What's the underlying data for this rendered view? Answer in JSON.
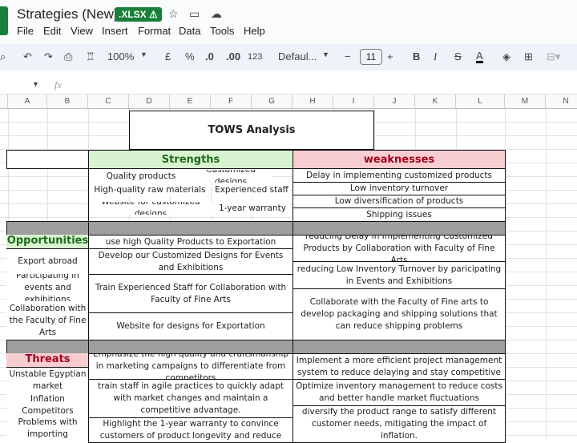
{
  "app": {
    "title": "Strategies (New)",
    "badge": ".XLSX ⚠",
    "icons": [
      "star-icon",
      "move-to-folder-icon",
      "cloud-status-icon"
    ]
  },
  "menu": [
    "File",
    "Edit",
    "View",
    "Insert",
    "Format",
    "Data",
    "Tools",
    "Help"
  ],
  "toolbar": {
    "zoom": "100%",
    "currency": "£",
    "percent": "%",
    "dec_decrease": ".0",
    "dec_increase": ".00",
    "number_format": "123",
    "font": "Defaul...",
    "font_size": "11",
    "minus": "−",
    "plus": "+",
    "bold": "B",
    "italic": "I",
    "strike": "S",
    "text_color": "A",
    "text_color_value": "#000000"
  },
  "formula_bar": {
    "fx": "fx",
    "cell_ref": ""
  },
  "columns": [
    "A",
    "B",
    "C",
    "D",
    "E",
    "F",
    "G",
    "H",
    "I",
    "J",
    "K",
    "L",
    "M",
    "N"
  ],
  "sheet": {
    "title": "TOWS Analysis",
    "strengths_header": "Strengths",
    "weaknesses_header": "weaknesses",
    "strengths": [
      "Quality products",
      "Customized designs",
      "High-quality raw materials",
      "Experienced staff",
      "Website for customized designs",
      "1-year warranty"
    ],
    "weaknesses": [
      "Delay in implementing customized products",
      "Low inventory turnover",
      "Low diversification of products",
      "Shipping issues"
    ],
    "opportunities_header": "Opportunities",
    "opportunities": [
      "Export abroad",
      "Participating in events and exhibitions",
      "Collaboration with the Faculty of Fine Arts"
    ],
    "so": [
      "use high Quality Products to Exportation",
      "Develop our Customized Designs  for Events and Exhibitions",
      "Train Experienced Staff for Collaboration with Faculty of Fine Arts",
      "Website for designs for Exportation"
    ],
    "wo": [
      "reducing Delay in Implementing Customized Products by Collaboration with Faculty of Fine Arts",
      "reducing Low Inventory Turnover by paricipating in Events and Exhibitions",
      "Collaborate with the Faculty of Fine arts to develop packaging and shipping solutions that can reduce shipping problems"
    ],
    "threats_header": "Threats",
    "threats": [
      "Unstable Egyptian market",
      "Inflation",
      "Competitors",
      "Problems with importing"
    ],
    "st": [
      "Emphasize the high quality and craftsmanship in marketing campaigns to differentiate from competitors",
      "train staff in agile practices to quickly adapt with market changes and maintain a competitive advantage.",
      "Highlight the 1-year warranty to convince customers of product longevity and reduce"
    ],
    "wt": [
      "Implement a more efficient project management system to reduce delaying and stay competitive",
      "Optimize inventory management to reduce costs and better handle market fluctuations",
      "diversify the product range to satisfy different customer needs, mitigating the impact of inflation."
    ]
  },
  "colors": {
    "strengths_bg": "#d9f2d0",
    "weaknesses_bg": "#f8cdd0",
    "strengths_text": "#1e6b1e",
    "weaknesses_text": "#a50021",
    "gray_row": "#9e9e9e",
    "brand": "#188038"
  }
}
